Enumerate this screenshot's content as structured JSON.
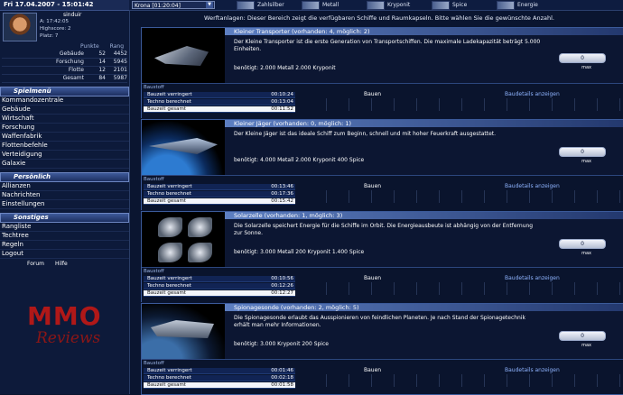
{
  "header": {
    "date": "Fri 17.04.2007 - 15:01:42",
    "planet": "Krona [01:20:04]",
    "resources": [
      "Zahlsilber",
      "Metall",
      "Kryponit",
      "Spice",
      "Energie"
    ]
  },
  "profile": {
    "name": "sinduir",
    "lines": [
      "A: 17:42:05",
      "Highscore: 2",
      "Platz: 7"
    ]
  },
  "stats": {
    "headers": [
      "Punkte",
      "Rang"
    ],
    "rows": [
      {
        "label": "Gebäude",
        "punkte": "52",
        "rang": "4452"
      },
      {
        "label": "Forschung",
        "punkte": "14",
        "rang": "5945"
      },
      {
        "label": "Flotte",
        "punkte": "12",
        "rang": "2101"
      },
      {
        "label": "Gesamt",
        "punkte": "84",
        "rang": "5987"
      }
    ]
  },
  "menu": {
    "spielmenu_title": "Spielmenü",
    "spielmenu": [
      "Kommandozentrale",
      "Gebäude",
      "Wirtschaft",
      "Forschung",
      "Waffenfabrik",
      "Flottenbefehle",
      "Verteidigung",
      "Galaxie"
    ],
    "persoenlich_title": "Persönlich",
    "persoenlich": [
      "Allianzen",
      "Nachrichten",
      "Einstellungen"
    ],
    "sonstiges_title": "Sonstiges",
    "sonstiges": [
      "Rangliste",
      "Techtree",
      "Regeln",
      "Logout"
    ],
    "footer_links": [
      "Forum",
      "Hilfe"
    ]
  },
  "logo": {
    "line1": "MMO",
    "line2": "Reviews"
  },
  "subline": "Werftanlagen: Dieser Bereich zeigt die verfügbaren Schiffe und Raumkapseln. Bitte wählen Sie die gewünschte Anzahl.",
  "ships": [
    {
      "title": "Kleiner Transporter (vorhanden: 4, möglich: 2)",
      "desc": "Der Kleine Transporter ist die erste Generation von Transportschiffen. Die maximale Ladekapazität beträgt 5.000 Einheiten.",
      "costs": "benötigt: 2.000 Metall  2.000 Kryponit",
      "qty_value": "0",
      "qty_label": "max",
      "panel_tab": "Baustoff",
      "rows": [
        {
          "label": "Bauzeit verringert",
          "value": "00:10:24"
        },
        {
          "label": "Techno berechnet",
          "value": "00:13:04"
        },
        {
          "label": "Bauzeit gesamt",
          "value": "00:11:52"
        }
      ],
      "bauen": "Bauen",
      "link": "Baudetails anzeigen"
    },
    {
      "title": "Kleiner Jäger (vorhanden: 0, möglich: 1)",
      "desc": "Der Kleine Jäger ist das ideale Schiff zum Beginn, schnell und mit hoher Feuerkraft ausgestattet.",
      "costs": "benötigt: 4.000 Metall  2.000 Kryponit  400 Spice",
      "qty_value": "0",
      "qty_label": "max",
      "panel_tab": "Baustoff",
      "rows": [
        {
          "label": "Bauzeit verringert",
          "value": "00:13:46"
        },
        {
          "label": "Techno berechnet",
          "value": "00:17:36"
        },
        {
          "label": "Bauzeit gesamt",
          "value": "00:15:42"
        }
      ],
      "bauen": "Bauen",
      "link": "Baudetails anzeigen"
    },
    {
      "title": "Solarzelle (vorhanden: 1, möglich: 3)",
      "desc": "Die Solarzelle speichert Energie für die Schiffe im Orbit. Die Energieausbeute ist abhängig von der Entfernung zur Sonne.",
      "costs": "benötigt: 3.000 Metall  200 Kryponit  1.400 Spice",
      "qty_value": "0",
      "qty_label": "max",
      "panel_tab": "Baustoff",
      "rows": [
        {
          "label": "Bauzeit verringert",
          "value": "00:10:56"
        },
        {
          "label": "Techno berechnet",
          "value": "00:12:26"
        },
        {
          "label": "Bauzeit gesamt",
          "value": "00:12:27"
        }
      ],
      "bauen": "Bauen",
      "link": "Baudetails anzeigen"
    },
    {
      "title": "Spionagesonde (vorhanden: 2, möglich: 5)",
      "desc": "Die Spionagesonde erlaubt das Ausspionieren von feindlichen Planeten. Je nach Stand der Spionagetechnik erhält man mehr Informationen.",
      "costs": "benötigt: 3.000 Kryponit  200 Spice",
      "qty_value": "0",
      "qty_label": "max",
      "panel_tab": "Baustoff",
      "rows": [
        {
          "label": "Bauzeit verringert",
          "value": "00:01:46"
        },
        {
          "label": "Techno berechnet",
          "value": "00:02:18"
        },
        {
          "label": "Bauzeit gesamt",
          "value": "00:01:58"
        }
      ],
      "bauen": "Bauen",
      "link": "Baudetails anzeigen"
    }
  ]
}
